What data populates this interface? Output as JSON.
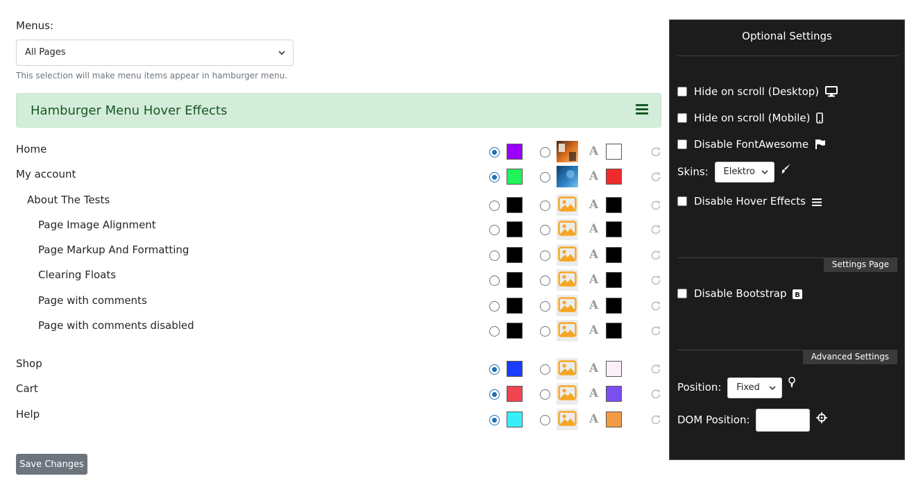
{
  "menus": {
    "label": "Menus:",
    "selected": "All Pages",
    "help": "This selection will make menu items appear in hamburger menu."
  },
  "section": {
    "title": "Hamburger Menu Hover Effects",
    "icon": "hamburger-icon"
  },
  "menu_items": [
    {
      "label": "Home",
      "level": 0,
      "color_selected": true,
      "bg_color": "#9b00ff",
      "image": "photo-orange",
      "text_color": "#ffffff"
    },
    {
      "label": "My account",
      "level": 0,
      "color_selected": true,
      "bg_color": "#21f35a",
      "image": "photo-blue",
      "text_color": "#f02b2b"
    },
    {
      "label": "About The Tests",
      "level": 1,
      "color_selected": false,
      "bg_color": "#000000",
      "image": "image-placeholder-icon",
      "text_color": "#000000"
    },
    {
      "label": "Page Image Alignment",
      "level": 2,
      "color_selected": false,
      "bg_color": "#000000",
      "image": "image-placeholder-icon",
      "text_color": "#000000"
    },
    {
      "label": "Page Markup And Formatting",
      "level": 2,
      "color_selected": false,
      "bg_color": "#000000",
      "image": "image-placeholder-icon",
      "text_color": "#000000"
    },
    {
      "label": "Clearing Floats",
      "level": 2,
      "color_selected": false,
      "bg_color": "#000000",
      "image": "image-placeholder-icon",
      "text_color": "#000000"
    },
    {
      "label": "Page with comments",
      "level": 2,
      "color_selected": false,
      "bg_color": "#000000",
      "image": "image-placeholder-icon",
      "text_color": "#000000"
    },
    {
      "label": "Page with comments disabled",
      "level": 2,
      "color_selected": false,
      "bg_color": "#000000",
      "image": "image-placeholder-icon",
      "text_color": "#000000"
    },
    {
      "label": "Shop",
      "level": 0,
      "color_selected": true,
      "bg_color": "#1a3dff",
      "image": "image-placeholder-icon",
      "text_color": "#fbf0f7"
    },
    {
      "label": "Cart",
      "level": 0,
      "color_selected": true,
      "bg_color": "#f04550",
      "image": "image-placeholder-icon",
      "text_color": "#7c4ff0"
    },
    {
      "label": "Help",
      "level": 0,
      "color_selected": true,
      "bg_color": "#38eefa",
      "image": "image-placeholder-icon",
      "text_color": "#f39a45"
    }
  ],
  "save_button": "Save Changes",
  "panel": {
    "title": "Optional Settings",
    "hide_scroll_desktop": {
      "label": "Hide on scroll (Desktop)",
      "checked": false,
      "icon": "desktop-icon"
    },
    "hide_scroll_mobile": {
      "label": "Hide on scroll (Mobile)",
      "checked": false,
      "icon": "mobile-icon"
    },
    "disable_fontawesome": {
      "label": "Disable FontAwesome",
      "checked": false,
      "icon": "flag-icon"
    },
    "skins": {
      "label": "Skins:",
      "selected": "Elektro",
      "icon": "paintbrush-icon"
    },
    "disable_hover": {
      "label": "Disable Hover Effects",
      "checked": false,
      "icon": "bars-icon"
    },
    "settings_page_tab": "Settings Page",
    "disable_bootstrap": {
      "label": "Disable Bootstrap",
      "checked": false,
      "icon": "bootstrap-icon"
    },
    "advanced_tab": "Advanced Settings",
    "position": {
      "label": "Position:",
      "selected": "Fixed",
      "icon": "map-pin-icon"
    },
    "dom_position": {
      "label": "DOM Position:",
      "value": "",
      "icon": "crosshairs-icon"
    }
  },
  "colors": {
    "panel_bg": "#1c1c1c",
    "section_bg": "#d4edda",
    "section_text": "#155724",
    "radio_accent": "#2271b1",
    "placeholder_orange": "#f5a623"
  }
}
